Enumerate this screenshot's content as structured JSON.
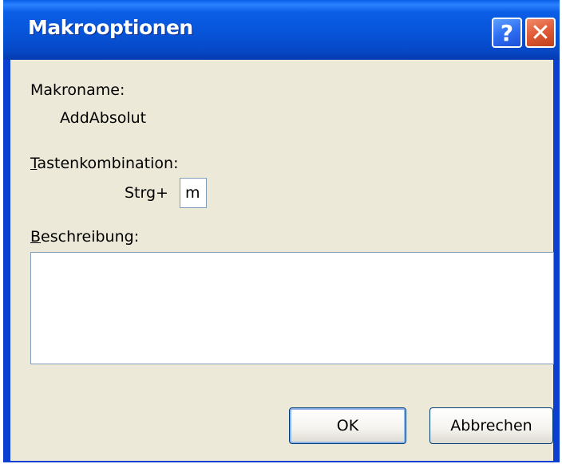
{
  "window": {
    "title": "Makrooptionen",
    "help_label": "?",
    "close_label": "✕"
  },
  "macro": {
    "name_label": "Makroname:",
    "name_value": "AddAbsolut"
  },
  "shortcut": {
    "label_mnemonic": "T",
    "label_rest": "astenkombination:",
    "prefix": "Strg+",
    "key_value": "m"
  },
  "description": {
    "label_mnemonic": "B",
    "label_rest": "eschreibung:",
    "value": ""
  },
  "buttons": {
    "ok_label": "OK",
    "cancel_label": "Abbrechen"
  }
}
